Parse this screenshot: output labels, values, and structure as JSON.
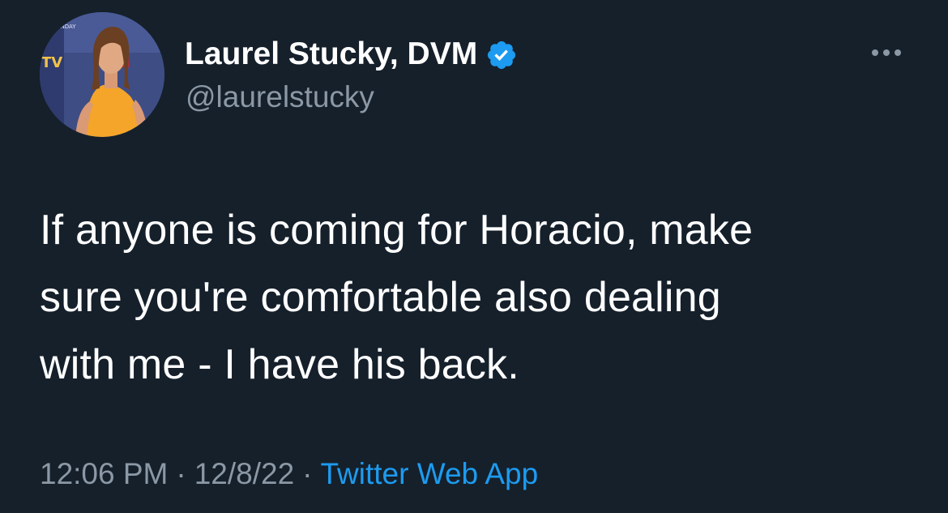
{
  "tweet": {
    "author": {
      "display_name": "Laurel Stucky, DVM",
      "handle": "@laurelstucky",
      "verified": true,
      "avatar_icon": "profile-photo"
    },
    "text_lines": [
      "If anyone is coming for Horacio, make",
      "sure you're comfortable also dealing",
      "with me - I have his back."
    ],
    "time": "12:06 PM",
    "date": "12/8/22",
    "separator": "·",
    "source": "Twitter Web App",
    "more_icon": "more-horizontal-icon"
  },
  "colors": {
    "background": "#15202b",
    "text_primary": "#ffffff",
    "text_secondary": "#8b98a5",
    "accent": "#1d9bf0"
  }
}
